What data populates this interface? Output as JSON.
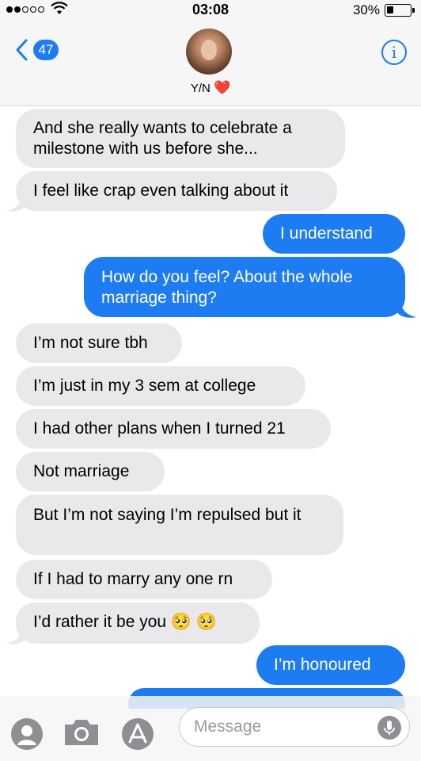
{
  "status_bar": {
    "time": "03:08",
    "battery": "30%",
    "battery_level": 0.3
  },
  "header": {
    "back_count": "47",
    "contact_name": "Y/N",
    "icons": [
      "chevron-left-icon",
      "info-icon",
      "heart-icon"
    ]
  },
  "messages": [
    {
      "type": "received",
      "text": "And she really wants to celebrate a milestone with us before she..."
    },
    {
      "type": "received",
      "text": "I feel like crap even talking about it"
    },
    {
      "type": "sent",
      "text": "I understand"
    },
    {
      "type": "sent",
      "text": "How do you feel? About the whole marriage thing?"
    },
    {
      "type": "received",
      "text": "I’m not sure tbh"
    },
    {
      "type": "received",
      "text": "I’m just in my 3 sem at college"
    },
    {
      "type": "received",
      "text": "I had other plans when I turned 21"
    },
    {
      "type": "received",
      "text": "Not marriage"
    },
    {
      "type": "received",
      "text": "But I’m not saying I’m repulsed but it"
    },
    {
      "type": "received",
      "text": "If I had to marry any one rn"
    },
    {
      "type": "received",
      "text": "I’d rather it be you 🥺 🥺"
    },
    {
      "type": "sent",
      "text": "I’m honoured"
    }
  ],
  "input": {
    "placeholder": "Message"
  },
  "colors": {
    "sent_bubble": "#1e7cf2",
    "received_bubble": "#e9e9eb",
    "accent": "#1e7cf2"
  }
}
